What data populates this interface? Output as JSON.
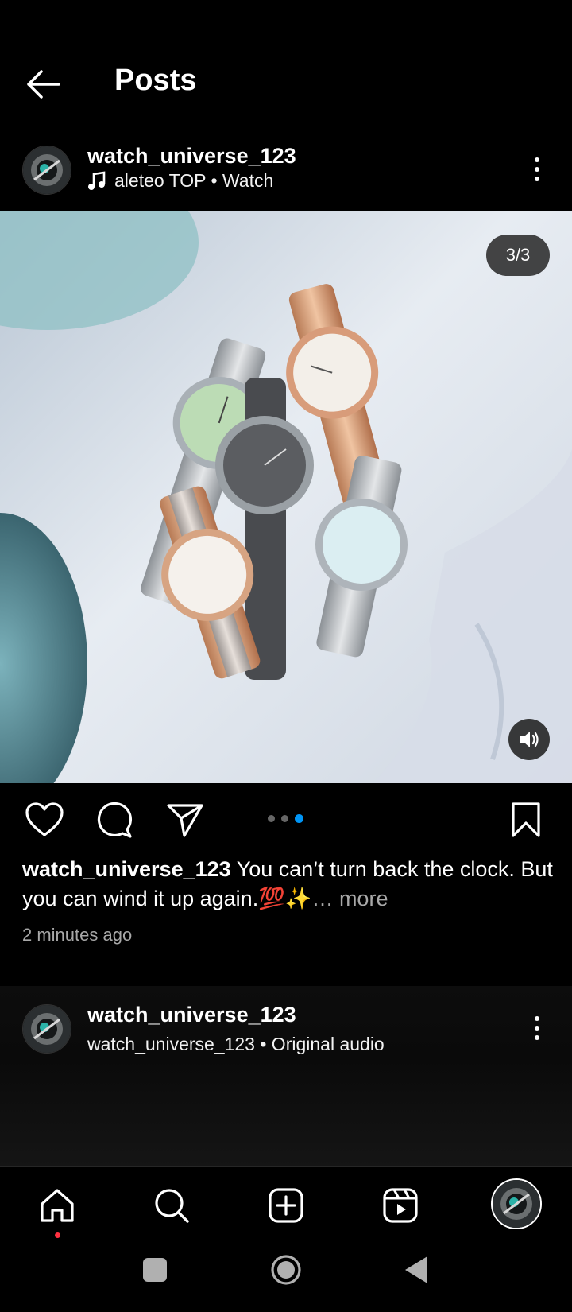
{
  "header": {
    "title": "Posts"
  },
  "post1": {
    "username": "watch_universe_123",
    "audio": "aleteo TOP • Watch",
    "counter": "3/3",
    "carousel_pages": 3,
    "carousel_active": 3,
    "caption_user": "watch_universe_123",
    "caption_text": "You can’t turn back the clock. But you can wind it up again.💯✨",
    "more_label": "… more",
    "time": "2 minutes ago"
  },
  "post2": {
    "username": "watch_universe_123",
    "audio": "watch_universe_123 • Original audio"
  },
  "nav": {
    "items": [
      "home-icon",
      "search-icon",
      "create-icon",
      "reels-icon",
      "profile-avatar"
    ],
    "notification_color": "#ff3040"
  },
  "colors": {
    "accent": "#0095f6",
    "background": "#000000",
    "secondary_text": "#a8a8a8"
  }
}
